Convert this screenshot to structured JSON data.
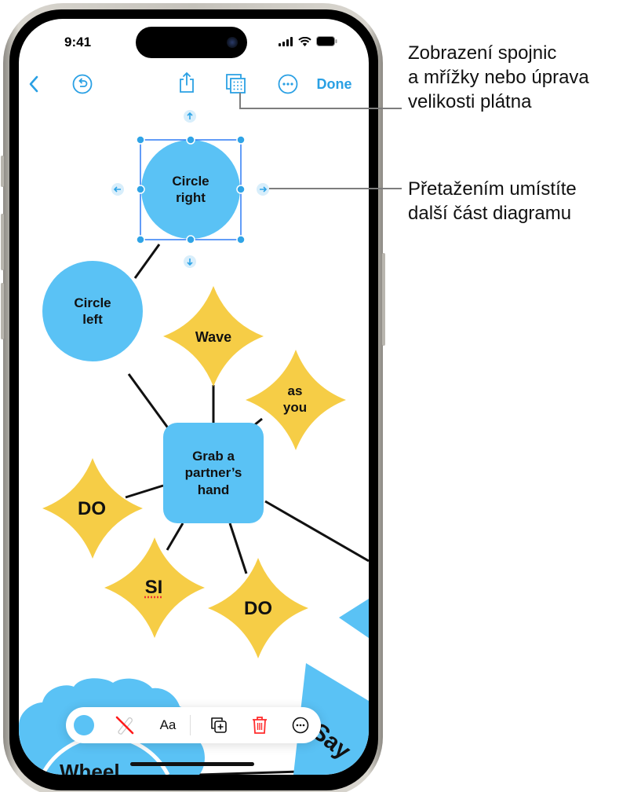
{
  "status_bar": {
    "time": "9:41",
    "icons": [
      "cellular-signal-icon",
      "wifi-icon",
      "battery-icon"
    ]
  },
  "toolbar": {
    "back_icon": "chevron-left-icon",
    "undo_icon": "undo-icon",
    "share_icon": "share-icon",
    "view_options_icon": "grid-layers-icon",
    "more_icon": "ellipsis-circle-icon",
    "done_label": "Done"
  },
  "diagram": {
    "accent_blue": "#5ac2f5",
    "accent_yellow": "#f6cd46",
    "selection_color": "#2f7cf6",
    "nodes": [
      {
        "id": "circle-right",
        "shape": "circle",
        "label_lines": [
          "Circle",
          "right"
        ],
        "selected": true
      },
      {
        "id": "circle-left",
        "shape": "circle",
        "label_lines": [
          "Circle",
          "left"
        ]
      },
      {
        "id": "grab-hand",
        "shape": "rounded-square",
        "label_lines": [
          "Grab a",
          "partner’s",
          "hand"
        ]
      },
      {
        "id": "wave",
        "shape": "star",
        "label_lines": [
          "Wave"
        ]
      },
      {
        "id": "as-you",
        "shape": "star",
        "label_lines": [
          "as",
          "you"
        ]
      },
      {
        "id": "do-left",
        "shape": "star",
        "label_lines": [
          "DO"
        ]
      },
      {
        "id": "si",
        "shape": "star",
        "label_lines": [
          "SI"
        ]
      },
      {
        "id": "do-bottom",
        "shape": "star",
        "label_lines": [
          "DO"
        ]
      },
      {
        "id": "wheel",
        "shape": "cloud",
        "label_lines": [
          "Wheel"
        ]
      },
      {
        "id": "say",
        "shape": "triangle",
        "label_lines": [
          "Say"
        ]
      }
    ],
    "labels": {
      "circle_right_1": "Circle",
      "circle_right_2": "right",
      "circle_left_1": "Circle",
      "circle_left_2": "left",
      "grab_1": "Grab a",
      "grab_2": "partner’s",
      "grab_3": "hand",
      "wave": "Wave",
      "as_you_1": "as",
      "as_you_2": "you",
      "do_left": "DO",
      "si": "SI",
      "do_bottom": "DO",
      "wheel": "Wheel",
      "say": "Say"
    }
  },
  "shape_toolbar": {
    "fill_color": "#5ac2f5",
    "stroke_icon": "no-stroke-icon",
    "text_style_label": "Aa",
    "duplicate_icon": "duplicate-icon",
    "delete_icon": "trash-icon",
    "delete_color": "#ff2d2d",
    "more_icon": "ellipsis-circle-icon"
  },
  "callouts": [
    {
      "id": "view-options",
      "text": "Zobrazení spojnic\na mřížky nebo úprava\nvelikosti plátna"
    },
    {
      "id": "drag-connect",
      "text": "Přetažením umístíte\ndalší část diagramu"
    }
  ]
}
